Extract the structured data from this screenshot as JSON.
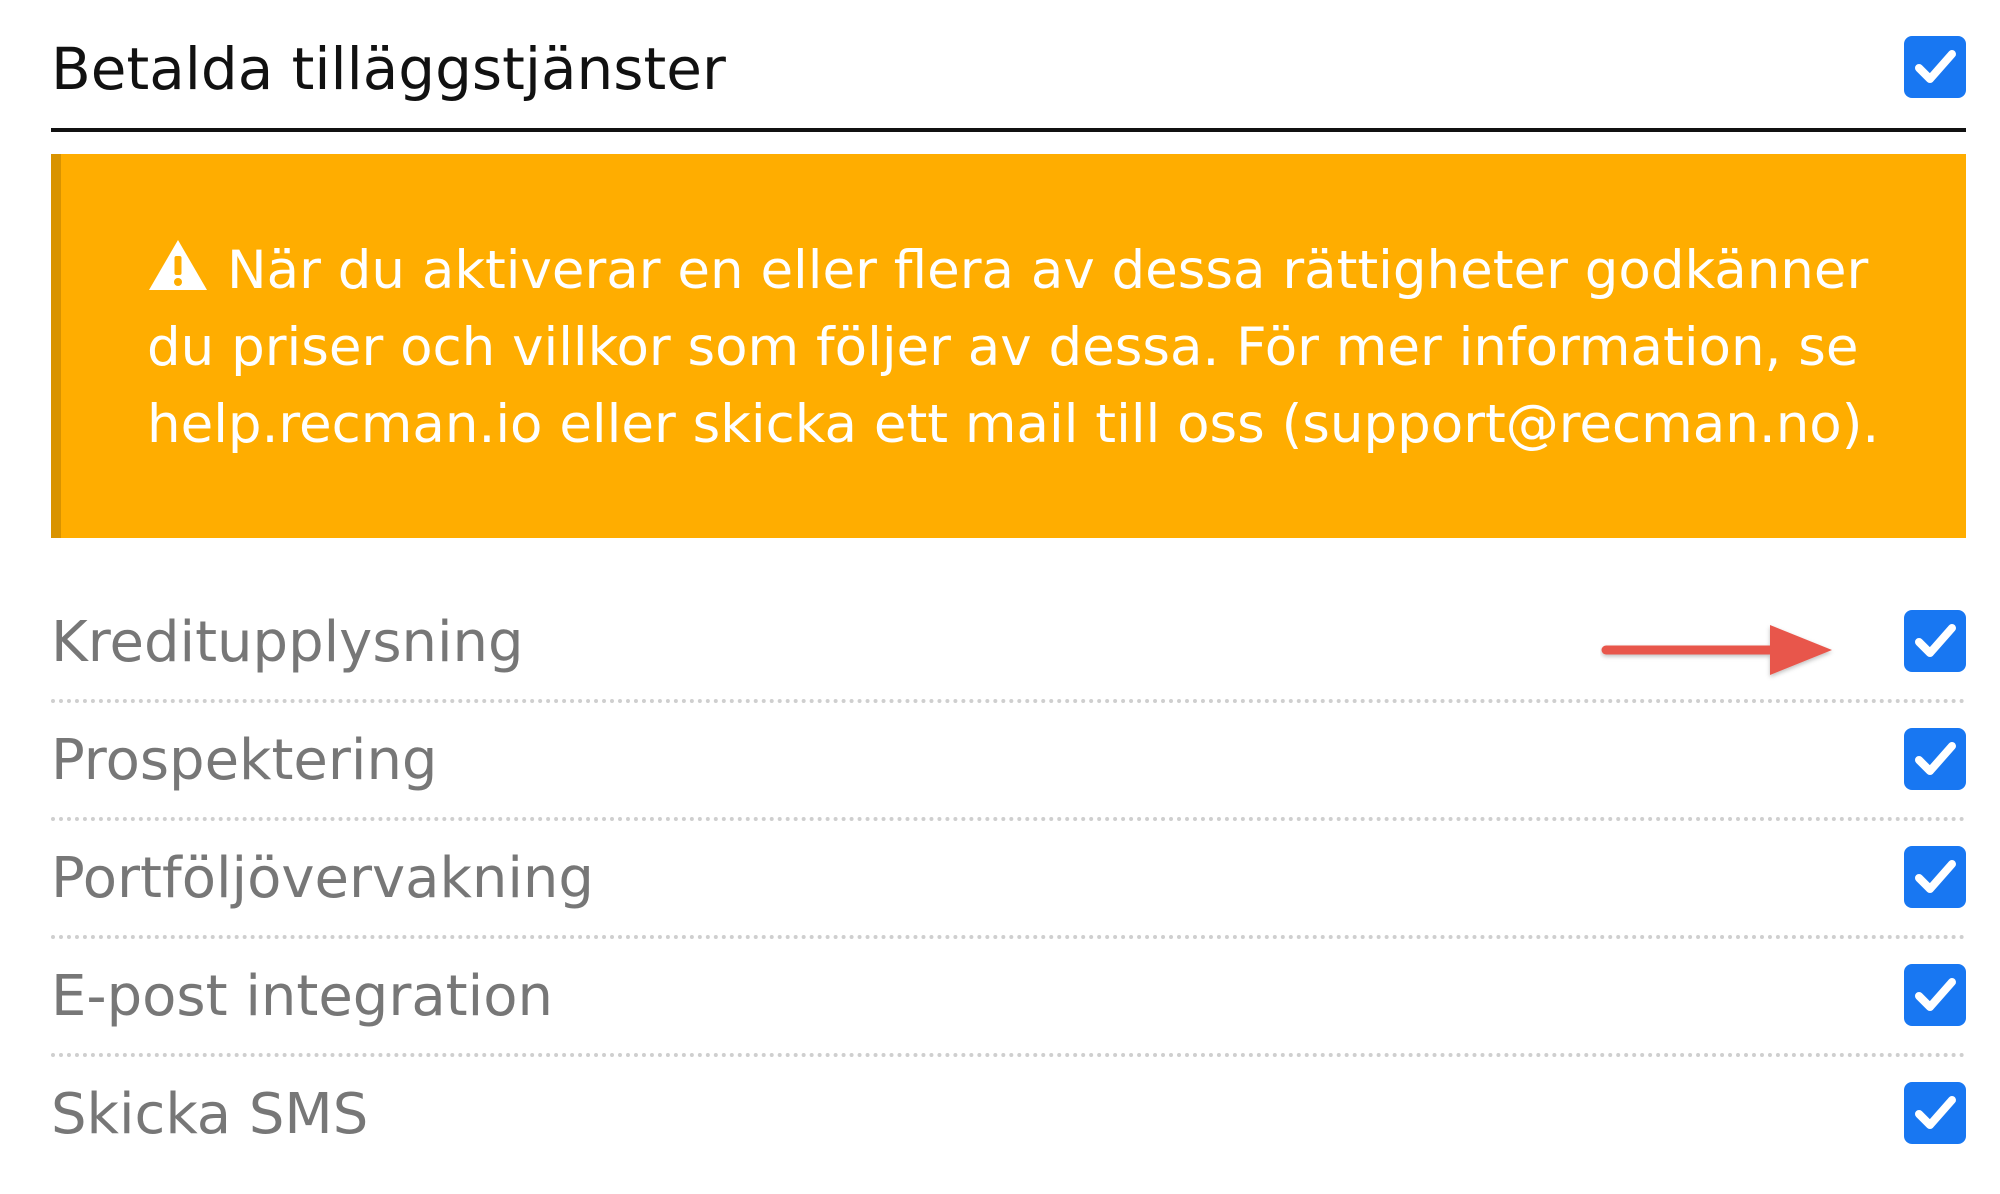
{
  "section": {
    "title": "Betalda tilläggstjänster",
    "enabled": true
  },
  "notice": {
    "lines": [
      "När du aktiverar en eller flera av dessa rättigheter godkänner",
      "du priser och villkor som följer av dessa. För mer information, se",
      "help.recman.io eller skicka ett mail till oss (support@recman.no)."
    ],
    "icon": "warning-triangle-icon",
    "background_color": "#ffad00",
    "text_color": "#ffffff"
  },
  "services": [
    {
      "label": "Kreditupplysning",
      "checked": true
    },
    {
      "label": "Prospektering",
      "checked": true
    },
    {
      "label": "Portföljövervakning",
      "checked": true
    },
    {
      "label": "E-post integration",
      "checked": true
    },
    {
      "label": "Skicka SMS",
      "checked": true
    }
  ],
  "annotation": {
    "icon": "red-arrow-icon",
    "color": "#e8574b"
  },
  "checkbox_color": "#1877f2"
}
